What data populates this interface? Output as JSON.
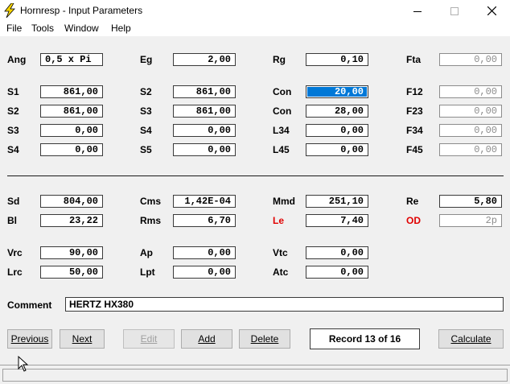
{
  "window": {
    "title": "Hornresp - Input Parameters"
  },
  "menu": [
    "File",
    "Tools",
    "Window",
    "Help"
  ],
  "horn_section": [
    {
      "label": "Ang",
      "value": "0,5 x Pi",
      "align": "left"
    },
    {
      "label": "Eg",
      "value": "2,00"
    },
    {
      "label": "Rg",
      "value": "0,10"
    },
    {
      "label": "Fta",
      "value": "0,00",
      "disabled": true
    },
    {
      "label": "S1",
      "value": "861,00"
    },
    {
      "label": "S2",
      "value": "861,00"
    },
    {
      "label": "Con",
      "value": "20,00",
      "selected": true
    },
    {
      "label": "F12",
      "value": "0,00",
      "disabled": true
    },
    {
      "label": "S2",
      "value": "861,00"
    },
    {
      "label": "S3",
      "value": "861,00"
    },
    {
      "label": "Con",
      "value": "28,00"
    },
    {
      "label": "F23",
      "value": "0,00",
      "disabled": true
    },
    {
      "label": "S3",
      "value": "0,00"
    },
    {
      "label": "S4",
      "value": "0,00"
    },
    {
      "label": "L34",
      "value": "0,00"
    },
    {
      "label": "F34",
      "value": "0,00",
      "disabled": true
    },
    {
      "label": "S4",
      "value": "0,00"
    },
    {
      "label": "S5",
      "value": "0,00"
    },
    {
      "label": "L45",
      "value": "0,00"
    },
    {
      "label": "F45",
      "value": "0,00",
      "disabled": true
    }
  ],
  "driver_section": [
    {
      "label": "Sd",
      "value": "804,00"
    },
    {
      "label": "Cms",
      "value": "1,42E-04"
    },
    {
      "label": "Mmd",
      "value": "251,10"
    },
    {
      "label": "Re",
      "value": "5,80"
    },
    {
      "label": "Bl",
      "value": "23,22"
    },
    {
      "label": "Rms",
      "value": "6,70"
    },
    {
      "label": "Le",
      "value": "7,40",
      "red": true
    },
    {
      "label": "OD",
      "value": "2p",
      "red": true,
      "disabled": true
    },
    {
      "label": "Vrc",
      "value": "90,00"
    },
    {
      "label": "Ap",
      "value": "0,00"
    },
    {
      "label": "Vtc",
      "value": "0,00"
    },
    {
      "label": "Lrc",
      "value": "50,00"
    },
    {
      "label": "Lpt",
      "value": "0,00"
    },
    {
      "label": "Atc",
      "value": "0,00"
    }
  ],
  "comment": {
    "label": "Comment",
    "value": "HERTZ HX380"
  },
  "buttons": {
    "previous": "Previous",
    "next": "Next",
    "edit": "Edit",
    "add": "Add",
    "delete": "Delete",
    "calculate": "Calculate"
  },
  "record": "Record 13 of 16",
  "colors": {
    "accent_red": "#e00000",
    "selection": "#0078d7"
  }
}
